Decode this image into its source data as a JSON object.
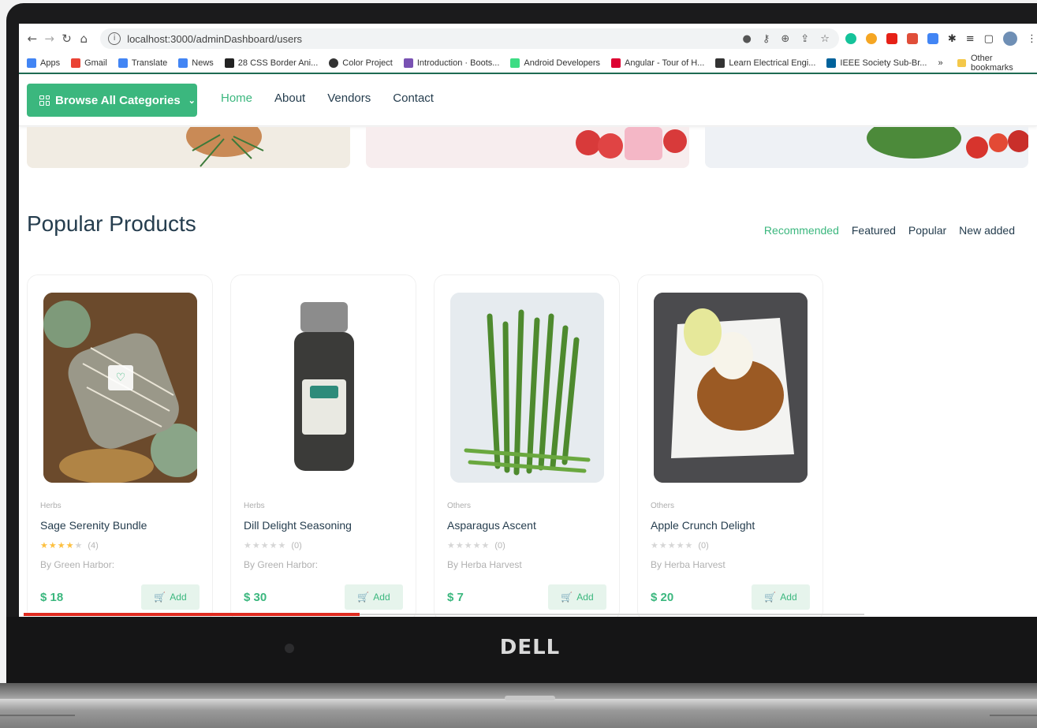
{
  "browser": {
    "url": "localhost:3000/adminDashboard/users",
    "bookmarks": [
      {
        "label": "Apps",
        "color": "#4285f4"
      },
      {
        "label": "Gmail",
        "color": "#ea4335"
      },
      {
        "label": "Translate",
        "color": "#4285f4"
      },
      {
        "label": "News",
        "color": "#4285f4"
      },
      {
        "label": "28 CSS Border Ani...",
        "color": "#222222"
      },
      {
        "label": "Color Project",
        "color": "#333333"
      },
      {
        "label": "Introduction · Boots...",
        "color": "#7952b3"
      },
      {
        "label": "Android Developers",
        "color": "#3ddc84"
      },
      {
        "label": "Angular - Tour of H...",
        "color": "#dd0031"
      },
      {
        "label": "Learn Electrical Engi...",
        "color": "#333333"
      },
      {
        "label": "IEEE Society Sub-Br...",
        "color": "#00629b"
      }
    ],
    "bookmarks_more": "»",
    "other_bookmarks": "Other bookmarks"
  },
  "header": {
    "browse_label": "Browse All Categories",
    "menu": [
      {
        "label": "Home",
        "active": true
      },
      {
        "label": "About",
        "active": false
      },
      {
        "label": "Vendors",
        "active": false
      },
      {
        "label": "Contact",
        "active": false
      }
    ]
  },
  "section": {
    "title": "Popular Products",
    "filters": [
      {
        "label": "Recommended",
        "active": true
      },
      {
        "label": "Featured",
        "active": false
      },
      {
        "label": "Popular",
        "active": false
      },
      {
        "label": "New added",
        "active": false
      }
    ]
  },
  "products": [
    {
      "category": "Herbs",
      "name": "Sage Serenity Bundle",
      "stars": 4,
      "reviews": "(4)",
      "vendor": "By Green Harbor:",
      "price": "$ 18",
      "add": "Add",
      "image": "sage-bundle"
    },
    {
      "category": "Herbs",
      "name": "Dill Delight Seasoning",
      "stars": 0,
      "reviews": "(0)",
      "vendor": "By Green Harbor:",
      "price": "$ 30",
      "add": "Add",
      "image": "spice-jar"
    },
    {
      "category": "Others",
      "name": "Asparagus Ascent",
      "stars": 0,
      "reviews": "(0)",
      "vendor": "By Herba Harvest",
      "price": "$ 7",
      "add": "Add",
      "image": "asparagus"
    },
    {
      "category": "Others",
      "name": "Apple Crunch Delight",
      "stars": 0,
      "reviews": "(0)",
      "vendor": "By Herba Harvest",
      "price": "$ 20",
      "add": "Add",
      "image": "apple-crisp"
    }
  ],
  "colors": {
    "accent": "#3bb77e",
    "heading": "#253d4e",
    "star": "#fdc040",
    "star_empty": "#d6d6d6"
  },
  "video_progress": 0.4,
  "device_brand": "DELL"
}
